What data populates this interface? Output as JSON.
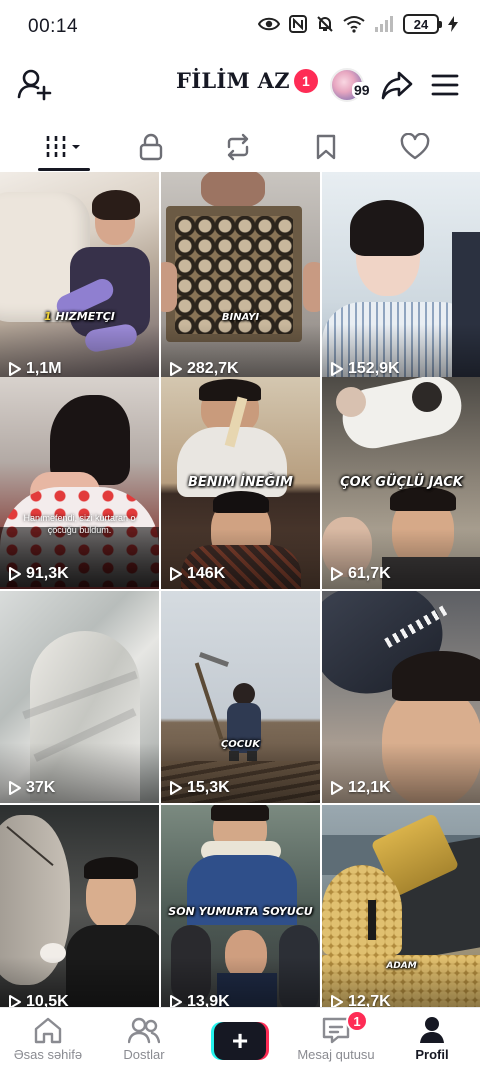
{
  "status_bar": {
    "time": "00:14",
    "battery": "24"
  },
  "header": {
    "title": "FİLİM AZ",
    "title_badge": "1",
    "story_count": "99"
  },
  "tabs": [
    {
      "name": "videos",
      "icon": "grid-icon",
      "active": true
    },
    {
      "name": "private",
      "icon": "lock-icon"
    },
    {
      "name": "reposts",
      "icon": "repost-icon"
    },
    {
      "name": "favorites",
      "icon": "bookmark-icon"
    },
    {
      "name": "liked",
      "icon": "heart-icon"
    }
  ],
  "videos": [
    {
      "views": "1,1M",
      "caption": "HIZMETÇI",
      "caption_prefix": "1"
    },
    {
      "views": "282,7K",
      "caption": "BINAYI"
    },
    {
      "views": "152,9K",
      "caption": ""
    },
    {
      "views": "91,3K",
      "caption": "",
      "subtitle": "Hanımefendi, sizi kurtaran o çocuğu buldum."
    },
    {
      "views": "146K",
      "caption": "BENIM İNEĞIM"
    },
    {
      "views": "61,7K",
      "caption": "ÇOK GÜÇLÜ JACK"
    },
    {
      "views": "37K",
      "caption": ""
    },
    {
      "views": "15,3K",
      "caption": "ÇOCUK"
    },
    {
      "views": "12,1K",
      "caption": ""
    },
    {
      "views": "10,5K",
      "caption": ""
    },
    {
      "views": "13,9K",
      "caption": "SON YUMURTA SOYUCU"
    },
    {
      "views": "12,7K",
      "caption": "ADAM"
    }
  ],
  "bottom_nav": {
    "home": "Əsas səhifə",
    "friends": "Dostlar",
    "create": "+",
    "inbox": "Mesaj qutusu",
    "inbox_badge": "1",
    "profile": "Profil"
  },
  "colors": {
    "accent": "#fe2c55",
    "cyan": "#25f4ee",
    "text": "#161823",
    "muted": "#8a8b91"
  }
}
